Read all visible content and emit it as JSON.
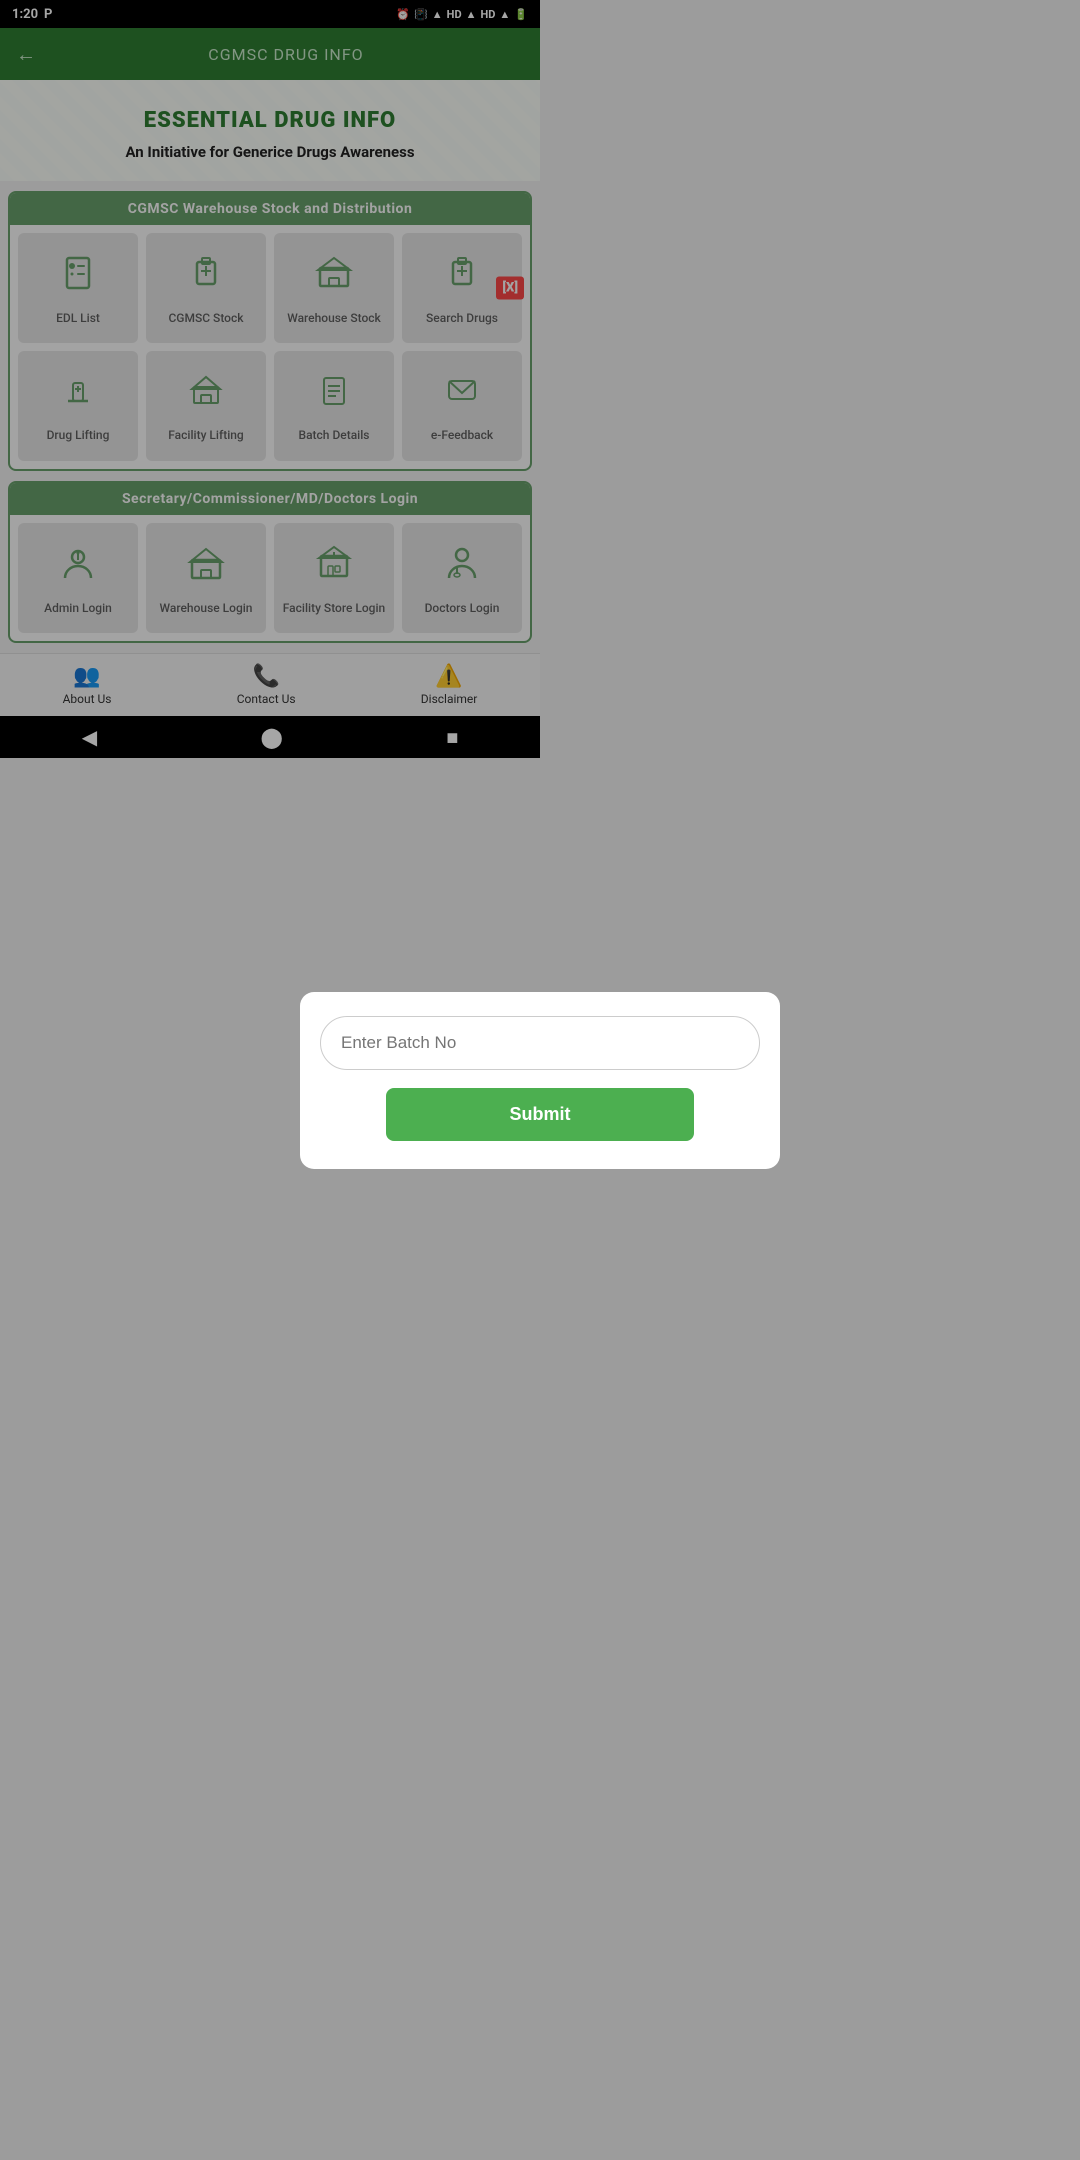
{
  "statusBar": {
    "time": "1:20",
    "icons": [
      "P",
      "alarm",
      "vibrate",
      "wifi",
      "HD",
      "signal",
      "HD",
      "signal2",
      "battery"
    ]
  },
  "topBar": {
    "title": "CGMSC DRUG INFO",
    "backLabel": "←"
  },
  "hero": {
    "title": "ESSENTIAL DRUG INFO",
    "subtitle": "An Initiative for Generice Drugs Awareness"
  },
  "warehouseSection": {
    "header": "CGMSC Warehouse Stock and Distribution",
    "items": [
      {
        "label": "EDL List",
        "icon": "💊"
      },
      {
        "label": "CGMSC Stock",
        "icon": "🏥"
      },
      {
        "label": "Warehouse Stock",
        "icon": "🏭"
      },
      {
        "label": "Search Drugs",
        "icon": "💊"
      }
    ],
    "row2items": [
      {
        "label": "Drug Lifting",
        "icon": "💉"
      },
      {
        "label": "Facility Lifting",
        "icon": "🏥"
      },
      {
        "label": "Batch Details",
        "icon": "📋"
      },
      {
        "label": "e-Feedback",
        "icon": "📝"
      }
    ]
  },
  "loginSection": {
    "header": "Secretary/Commissioner/MD/Doctors Login",
    "items": [
      {
        "label": "Admin Login",
        "icon": "👤"
      },
      {
        "label": "Warehouse Login",
        "icon": "🏭"
      },
      {
        "label": "Facility Store Login",
        "icon": "🏥"
      },
      {
        "label": "Doctors Login",
        "icon": "👨‍⚕️"
      }
    ]
  },
  "modal": {
    "placeholder": "Enter Batch No",
    "submitLabel": "Submit"
  },
  "footer": {
    "items": [
      {
        "label": "About Us",
        "icon": "👥"
      },
      {
        "label": "Contact Us",
        "icon": "📞"
      },
      {
        "label": "Disclaimer",
        "icon": "⚠️"
      }
    ]
  },
  "navBar": {
    "back": "◀",
    "home": "⬤",
    "square": "■"
  }
}
